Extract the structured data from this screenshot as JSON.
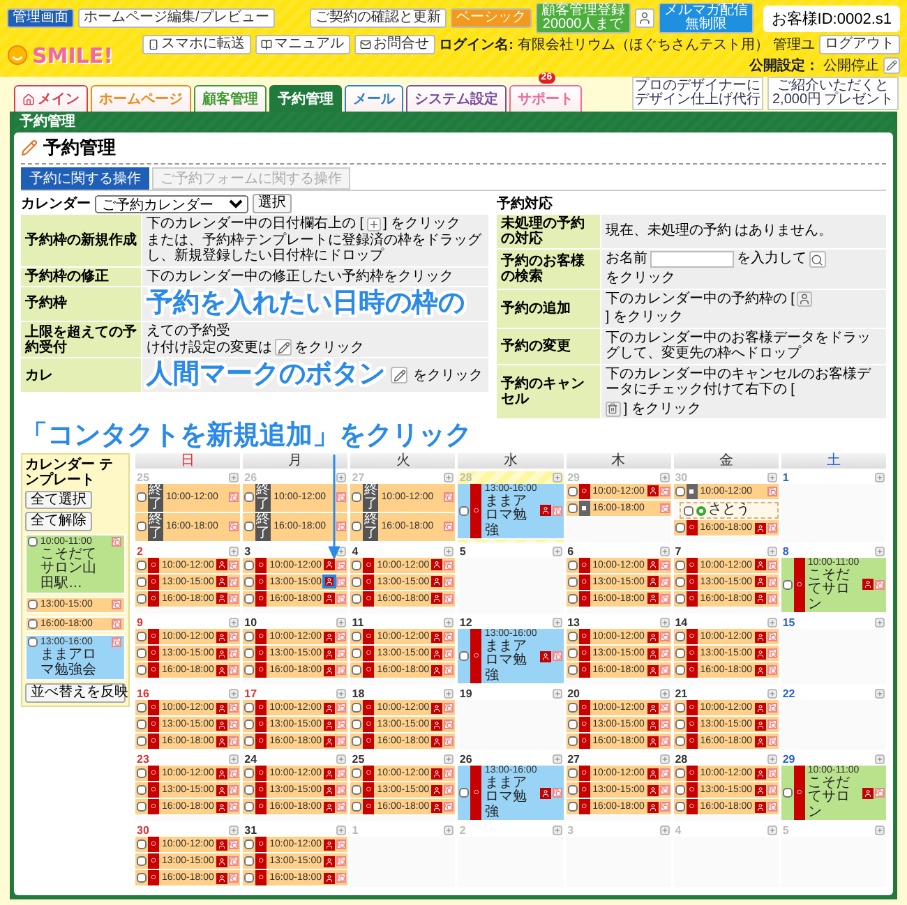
{
  "topbar": {
    "admin": "管理画面",
    "editor": "ホームページ編集/プレビュー",
    "contract": "ご契約の確認と更新",
    "plan": "ベーシック",
    "customers": [
      "顧客管理登録",
      "20000人まで"
    ],
    "mailmag": [
      "メルマガ配信",
      "無制限"
    ],
    "customer_id": "お客様ID:0002.s1"
  },
  "logo": "SMILE!",
  "userbar": {
    "links": [
      "スマホに転送",
      "マニュアル",
      "お問合せ"
    ],
    "login_label": "ログイン名:",
    "login_name": "有限会社リウム（ほぐちさんテスト用）",
    "role": "管理ユ",
    "logout": "ログアウト",
    "publish_label": "公開設定：",
    "publish_value": "公開停止"
  },
  "tabs": [
    {
      "label": "メイン",
      "selected": false,
      "color": "#d9404f"
    },
    {
      "label": "ホームページ",
      "selected": false,
      "color": "#f08a1c"
    },
    {
      "label": "顧客管理",
      "selected": false,
      "color": "#3f9a2f"
    },
    {
      "label": "予約管理",
      "selected": true,
      "color": "#1f7a3c"
    },
    {
      "label": "メール",
      "selected": false,
      "color": "#2f7fd0"
    },
    {
      "label": "システム設定",
      "selected": false,
      "color": "#7a4fa0"
    },
    {
      "label": "サポート",
      "selected": false,
      "color": "#f06a9a",
      "badge": "26"
    }
  ],
  "banners": [
    {
      "lines": [
        "プロのデザイナーに",
        "デザイン仕上げ代行"
      ]
    },
    {
      "lines": [
        "ご紹介いただくと",
        "2,000円",
        "プレゼント"
      ]
    }
  ],
  "panel": {
    "title": "予約管理",
    "heading": "予約管理",
    "subtabs": [
      {
        "label": "予約に関する操作",
        "selected": true
      },
      {
        "label": "ご予約フォームに関する操作",
        "selected": false
      }
    ]
  },
  "calendar_select": {
    "label": "カレンダー",
    "value": "ご予約カレンダー",
    "button": "選択"
  },
  "left_ops": [
    {
      "label": "予約枠の新規作成",
      "lines": [
        [
          {
            "kind": "text",
            "text": "下のカレンダー中の日付欄右上の ["
          },
          {
            "kind": "plus"
          },
          {
            "kind": "text",
            "text": "] をクリック"
          }
        ],
        [
          {
            "kind": "text",
            "text": "または、予約枠テンプレートに登録済の枠をドラッグし、新規登録したい日付枠にドロップ"
          }
        ]
      ]
    },
    {
      "label": "予約枠の修正",
      "lines": [
        [
          {
            "kind": "text",
            "text": "下のカレンダー中の修正したい予約枠をクリック"
          }
        ]
      ]
    },
    {
      "label": "予約枠",
      "callout": "予約を入れたい日時の枠の"
    },
    {
      "label": "上限を超えての予約受付",
      "lines": [
        [
          {
            "kind": "text",
            "text": "えての予約受"
          }
        ],
        [
          {
            "kind": "text",
            "text": "け付け設定の変更は"
          },
          {
            "kind": "pencil"
          },
          {
            "kind": "text",
            "text": "をクリック"
          }
        ]
      ]
    },
    {
      "label": "カレ",
      "callout": "人間マークのボタン",
      "lines": [
        [
          {
            "kind": "pencil"
          },
          {
            "kind": "text",
            "text": "をクリック"
          }
        ]
      ]
    }
  ],
  "right_ops": {
    "title": "予約対応",
    "rows": [
      {
        "label": "未処理の予約の対応",
        "lines": [
          [
            {
              "kind": "text",
              "text": "現在、未処理の予約 はありません。"
            }
          ]
        ]
      },
      {
        "label": "予約のお客様の検索",
        "lines": [
          [
            {
              "kind": "text",
              "text": "お名前"
            },
            {
              "kind": "input"
            },
            {
              "kind": "text",
              "text": "を入力して"
            },
            {
              "kind": "search"
            },
            {
              "kind": "text",
              "text": "をクリック"
            }
          ]
        ]
      },
      {
        "label": "予約の追加",
        "lines": [
          [
            {
              "kind": "text",
              "text": "下のカレンダー中の予約枠の ["
            },
            {
              "kind": "person"
            },
            {
              "kind": "text",
              "text": "] をクリック"
            }
          ]
        ]
      },
      {
        "label": "予約の変更",
        "lines": [
          [
            {
              "kind": "text",
              "text": "下のカレンダー中のお客様データをドラッグして、変更先の枠へドロップ"
            }
          ]
        ]
      },
      {
        "label": "予約のキャンセル",
        "lines": [
          [
            {
              "kind": "text",
              "text": "下のカレンダー中のキャンセルのお客様データにチェック付けて右下の ["
            },
            {
              "kind": "trash"
            },
            {
              "kind": "text",
              "text": "] をクリック"
            }
          ]
        ]
      }
    ]
  },
  "calendar_callout": "「コンタクトを新規追加」をクリック",
  "template": {
    "title": "カレンダー テンプレート",
    "buttons": [
      "全て選択",
      "全て解除"
    ],
    "items": [
      {
        "time": "10:00-11:00",
        "name": "こそだてサロン山田駅…",
        "color": "#b9e28c"
      },
      {
        "time": "13:00-15:00",
        "color": "#ffd08a"
      },
      {
        "time": "16:00-18:00",
        "color": "#ffd08a"
      },
      {
        "time": "13:00-16:00",
        "name": "ままアロマ勉強会",
        "color": "#99d3f5"
      }
    ],
    "apply": "並べ替えを反映"
  },
  "weekdays": [
    {
      "label": "日",
      "kind": "sun"
    },
    {
      "label": "月",
      "kind": "day"
    },
    {
      "label": "火",
      "kind": "day"
    },
    {
      "label": "水",
      "kind": "day"
    },
    {
      "label": "木",
      "kind": "day"
    },
    {
      "label": "金",
      "kind": "day"
    },
    {
      "label": "土",
      "kind": "sat"
    }
  ],
  "weeks": [
    {
      "days": [
        {
          "date": "25",
          "kind": "other",
          "today": false,
          "slots": [
            {
              "kind": "done",
              "time": "10:00-12:00",
              "mark": "終了",
              "color": "#ffd08a",
              "highlighted": false
            },
            {
              "kind": "done",
              "time": "16:00-18:00",
              "mark": "終了",
              "color": "#ffd08a",
              "highlighted": false
            }
          ]
        },
        {
          "date": "26",
          "kind": "other",
          "today": false,
          "slots": [
            {
              "kind": "done",
              "time": "10:00-12:00",
              "mark": "終了",
              "color": "#ffd08a",
              "highlighted": false
            },
            {
              "kind": "done",
              "time": "16:00-18:00",
              "mark": "終了",
              "color": "#ffd08a",
              "highlighted": false
            }
          ]
        },
        {
          "date": "27",
          "kind": "other",
          "today": false,
          "slots": [
            {
              "kind": "done",
              "time": "10:00-12:00",
              "mark": "終了",
              "color": "#ffd08a",
              "highlighted": false
            },
            {
              "kind": "done",
              "time": "16:00-18:00",
              "mark": "終了",
              "color": "#ffd08a",
              "highlighted": false
            }
          ]
        },
        {
          "date": "28",
          "kind": "other",
          "today": true,
          "slots": [
            {
              "kind": "open",
              "time": "13:00-16:00",
              "name": "ままアロマ勉強",
              "mark": "○",
              "color": "#99d3f5",
              "highlighted": false
            }
          ]
        },
        {
          "date": "29",
          "kind": "other",
          "today": false,
          "slots": [
            {
              "kind": "open",
              "time": "10:00-12:00",
              "mark": "○",
              "color": "#ffd08a",
              "highlighted": false
            },
            {
              "kind": "closed",
              "time": "16:00-18:00",
              "color": "#ffd08a",
              "highlighted": false
            }
          ]
        },
        {
          "date": "30",
          "kind": "other",
          "today": false,
          "slots": [
            {
              "kind": "closed",
              "time": "10:00-12:00",
              "color": "#ffd08a",
              "highlighted": false
            },
            {
              "kind": "booking",
              "name": "さとう"
            },
            {
              "kind": "open",
              "time": "16:00-18:00",
              "mark": "○",
              "color": "#ffd08a",
              "highlighted": false
            }
          ]
        },
        {
          "date": "1",
          "kind": "sat",
          "today": false
        }
      ]
    },
    {
      "days": [
        {
          "date": "2",
          "kind": "sun",
          "today": false,
          "slots": [
            {
              "kind": "open",
              "time": "10:00-12:00",
              "mark": "○",
              "color": "#ffd08a",
              "highlighted": false
            },
            {
              "kind": "open",
              "time": "13:00-15:00",
              "mark": "○",
              "color": "#ffd08a",
              "highlighted": false
            },
            {
              "kind": "open",
              "time": "16:00-18:00",
              "mark": "○",
              "color": "#ffd08a",
              "highlighted": false
            }
          ]
        },
        {
          "date": "3",
          "kind": "day",
          "today": false,
          "slots": [
            {
              "kind": "open",
              "time": "10:00-12:00",
              "mark": "○",
              "color": "#ffd08a",
              "highlighted": false
            },
            {
              "kind": "open",
              "time": "13:00-15:00",
              "mark": "○",
              "color": "#ffd08a",
              "highlighted": true
            },
            {
              "kind": "open",
              "time": "16:00-18:00",
              "mark": "○",
              "color": "#ffd08a",
              "highlighted": false
            }
          ]
        },
        {
          "date": "4",
          "kind": "day",
          "today": false,
          "slots": [
            {
              "kind": "open",
              "time": "10:00-12:00",
              "mark": "○",
              "color": "#ffd08a",
              "highlighted": false
            },
            {
              "kind": "open",
              "time": "13:00-15:00",
              "mark": "○",
              "color": "#ffd08a",
              "highlighted": false
            },
            {
              "kind": "open",
              "time": "16:00-18:00",
              "mark": "○",
              "color": "#ffd08a",
              "highlighted": false
            }
          ]
        },
        {
          "date": "5",
          "kind": "day",
          "today": false
        },
        {
          "date": "6",
          "kind": "day",
          "today": false,
          "slots": [
            {
              "kind": "open",
              "time": "10:00-12:00",
              "mark": "○",
              "color": "#ffd08a",
              "highlighted": false
            },
            {
              "kind": "open",
              "time": "13:00-15:00",
              "mark": "○",
              "color": "#ffd08a",
              "highlighted": false
            },
            {
              "kind": "open",
              "time": "16:00-18:00",
              "mark": "○",
              "color": "#ffd08a",
              "highlighted": false
            }
          ]
        },
        {
          "date": "7",
          "kind": "day",
          "today": false,
          "slots": [
            {
              "kind": "open",
              "time": "10:00-12:00",
              "mark": "○",
              "color": "#ffd08a",
              "highlighted": false
            },
            {
              "kind": "open",
              "time": "13:00-15:00",
              "mark": "○",
              "color": "#ffd08a",
              "highlighted": false
            },
            {
              "kind": "open",
              "time": "16:00-18:00",
              "mark": "○",
              "color": "#ffd08a",
              "highlighted": false
            }
          ]
        },
        {
          "date": "8",
          "kind": "sat",
          "today": false,
          "slots": [
            {
              "kind": "open",
              "time": "10:00-11:00",
              "name": "こそだてサロン",
              "mark": "○",
              "color": "#b9e28c",
              "highlighted": false
            }
          ]
        }
      ]
    },
    {
      "days": [
        {
          "date": "9",
          "kind": "sun",
          "today": false,
          "slots": [
            {
              "kind": "open",
              "time": "10:00-12:00",
              "mark": "○",
              "color": "#ffd08a",
              "highlighted": false
            },
            {
              "kind": "open",
              "time": "13:00-15:00",
              "mark": "○",
              "color": "#ffd08a",
              "highlighted": false
            },
            {
              "kind": "open",
              "time": "16:00-18:00",
              "mark": "○",
              "color": "#ffd08a",
              "highlighted": false
            }
          ]
        },
        {
          "date": "10",
          "kind": "day",
          "today": false,
          "slots": [
            {
              "kind": "open",
              "time": "10:00-12:00",
              "mark": "○",
              "color": "#ffd08a",
              "highlighted": false
            },
            {
              "kind": "open",
              "time": "13:00-15:00",
              "mark": "○",
              "color": "#ffd08a",
              "highlighted": false
            },
            {
              "kind": "open",
              "time": "16:00-18:00",
              "mark": "○",
              "color": "#ffd08a",
              "highlighted": false
            }
          ]
        },
        {
          "date": "11",
          "kind": "day",
          "today": false,
          "slots": [
            {
              "kind": "open",
              "time": "10:00-12:00",
              "mark": "○",
              "color": "#ffd08a",
              "highlighted": false
            },
            {
              "kind": "open",
              "time": "13:00-15:00",
              "mark": "○",
              "color": "#ffd08a",
              "highlighted": false
            },
            {
              "kind": "open",
              "time": "16:00-18:00",
              "mark": "○",
              "color": "#ffd08a",
              "highlighted": false
            }
          ]
        },
        {
          "date": "12",
          "kind": "day",
          "today": false,
          "slots": [
            {
              "kind": "open",
              "time": "13:00-16:00",
              "name": "ままアロマ勉強",
              "mark": "○",
              "color": "#99d3f5",
              "highlighted": false
            }
          ]
        },
        {
          "date": "13",
          "kind": "day",
          "today": false,
          "slots": [
            {
              "kind": "open",
              "time": "10:00-12:00",
              "mark": "○",
              "color": "#ffd08a",
              "highlighted": false
            },
            {
              "kind": "open",
              "time": "13:00-15:00",
              "mark": "○",
              "color": "#ffd08a",
              "highlighted": false
            },
            {
              "kind": "open",
              "time": "16:00-18:00",
              "mark": "○",
              "color": "#ffd08a",
              "highlighted": false
            }
          ]
        },
        {
          "date": "14",
          "kind": "day",
          "today": false,
          "slots": [
            {
              "kind": "open",
              "time": "10:00-12:00",
              "mark": "○",
              "color": "#ffd08a",
              "highlighted": false
            },
            {
              "kind": "open",
              "time": "13:00-15:00",
              "mark": "○",
              "color": "#ffd08a",
              "highlighted": false
            },
            {
              "kind": "open",
              "time": "16:00-18:00",
              "mark": "○",
              "color": "#ffd08a",
              "highlighted": false
            }
          ]
        },
        {
          "date": "15",
          "kind": "sat",
          "today": false
        }
      ]
    },
    {
      "days": [
        {
          "date": "16",
          "kind": "sun",
          "today": false,
          "slots": [
            {
              "kind": "open",
              "time": "10:00-12:00",
              "mark": "○",
              "color": "#ffd08a",
              "highlighted": false
            },
            {
              "kind": "open",
              "time": "13:00-15:00",
              "mark": "○",
              "color": "#ffd08a",
              "highlighted": false
            },
            {
              "kind": "open",
              "time": "16:00-18:00",
              "mark": "○",
              "color": "#ffd08a",
              "highlighted": false
            }
          ]
        },
        {
          "date": "17",
          "kind": "sun",
          "today": false,
          "slots": [
            {
              "kind": "open",
              "time": "10:00-12:00",
              "mark": "○",
              "color": "#ffd08a",
              "highlighted": false
            },
            {
              "kind": "open",
              "time": "13:00-15:00",
              "mark": "○",
              "color": "#ffd08a",
              "highlighted": false
            },
            {
              "kind": "open",
              "time": "16:00-18:00",
              "mark": "○",
              "color": "#ffd08a",
              "highlighted": false
            }
          ]
        },
        {
          "date": "18",
          "kind": "day",
          "today": false,
          "slots": [
            {
              "kind": "open",
              "time": "10:00-12:00",
              "mark": "○",
              "color": "#ffd08a",
              "highlighted": false
            },
            {
              "kind": "open",
              "time": "13:00-15:00",
              "mark": "○",
              "color": "#ffd08a",
              "highlighted": false
            },
            {
              "kind": "open",
              "time": "16:00-18:00",
              "mark": "○",
              "color": "#ffd08a",
              "highlighted": false
            }
          ]
        },
        {
          "date": "19",
          "kind": "day",
          "today": false
        },
        {
          "date": "20",
          "kind": "day",
          "today": false,
          "slots": [
            {
              "kind": "open",
              "time": "10:00-12:00",
              "mark": "○",
              "color": "#ffd08a",
              "highlighted": false
            },
            {
              "kind": "open",
              "time": "13:00-15:00",
              "mark": "○",
              "color": "#ffd08a",
              "highlighted": false
            },
            {
              "kind": "open",
              "time": "16:00-18:00",
              "mark": "○",
              "color": "#ffd08a",
              "highlighted": false
            }
          ]
        },
        {
          "date": "21",
          "kind": "day",
          "today": false,
          "slots": [
            {
              "kind": "open",
              "time": "10:00-12:00",
              "mark": "○",
              "color": "#ffd08a",
              "highlighted": false
            },
            {
              "kind": "open",
              "time": "13:00-15:00",
              "mark": "○",
              "color": "#ffd08a",
              "highlighted": false
            },
            {
              "kind": "open",
              "time": "16:00-18:00",
              "mark": "○",
              "color": "#ffd08a",
              "highlighted": false
            }
          ]
        },
        {
          "date": "22",
          "kind": "sat",
          "today": false
        }
      ]
    },
    {
      "days": [
        {
          "date": "23",
          "kind": "sun",
          "today": false,
          "slots": [
            {
              "kind": "open",
              "time": "10:00-12:00",
              "mark": "○",
              "color": "#ffd08a",
              "highlighted": false
            },
            {
              "kind": "open",
              "time": "13:00-15:00",
              "mark": "○",
              "color": "#ffd08a",
              "highlighted": false
            },
            {
              "kind": "open",
              "time": "16:00-18:00",
              "mark": "○",
              "color": "#ffd08a",
              "highlighted": false
            }
          ]
        },
        {
          "date": "24",
          "kind": "day",
          "today": false,
          "slots": [
            {
              "kind": "open",
              "time": "10:00-12:00",
              "mark": "○",
              "color": "#ffd08a",
              "highlighted": false
            },
            {
              "kind": "open",
              "time": "13:00-15:00",
              "mark": "○",
              "color": "#ffd08a",
              "highlighted": false
            },
            {
              "kind": "open",
              "time": "16:00-18:00",
              "mark": "○",
              "color": "#ffd08a",
              "highlighted": false
            }
          ]
        },
        {
          "date": "25",
          "kind": "day",
          "today": false,
          "slots": [
            {
              "kind": "open",
              "time": "10:00-12:00",
              "mark": "○",
              "color": "#ffd08a",
              "highlighted": false
            },
            {
              "kind": "open",
              "time": "13:00-15:00",
              "mark": "○",
              "color": "#ffd08a",
              "highlighted": false
            },
            {
              "kind": "open",
              "time": "16:00-18:00",
              "mark": "○",
              "color": "#ffd08a",
              "highlighted": false
            }
          ]
        },
        {
          "date": "26",
          "kind": "day",
          "today": false,
          "slots": [
            {
              "kind": "open",
              "time": "13:00-16:00",
              "name": "ままアロマ勉強",
              "mark": "○",
              "color": "#99d3f5",
              "highlighted": false
            }
          ]
        },
        {
          "date": "27",
          "kind": "day",
          "today": false,
          "slots": [
            {
              "kind": "open",
              "time": "10:00-12:00",
              "mark": "○",
              "color": "#ffd08a",
              "highlighted": false
            },
            {
              "kind": "open",
              "time": "13:00-15:00",
              "mark": "○",
              "color": "#ffd08a",
              "highlighted": false
            },
            {
              "kind": "open",
              "time": "16:00-18:00",
              "mark": "○",
              "color": "#ffd08a",
              "highlighted": false
            }
          ]
        },
        {
          "date": "28",
          "kind": "day",
          "today": false,
          "slots": [
            {
              "kind": "open",
              "time": "10:00-12:00",
              "mark": "○",
              "color": "#ffd08a",
              "highlighted": false
            },
            {
              "kind": "open",
              "time": "13:00-15:00",
              "mark": "○",
              "color": "#ffd08a",
              "highlighted": false
            },
            {
              "kind": "open",
              "time": "16:00-18:00",
              "mark": "○",
              "color": "#ffd08a",
              "highlighted": false
            }
          ]
        },
        {
          "date": "29",
          "kind": "sat",
          "today": false,
          "slots": [
            {
              "kind": "open",
              "time": "10:00-11:00",
              "name": "こそだてサロン",
              "mark": "○",
              "color": "#b9e28c",
              "highlighted": false
            }
          ]
        }
      ]
    },
    {
      "days": [
        {
          "date": "30",
          "kind": "sun",
          "today": false,
          "slots": [
            {
              "kind": "open",
              "time": "10:00-12:00",
              "mark": "○",
              "color": "#ffd08a",
              "highlighted": false
            },
            {
              "kind": "open",
              "time": "13:00-15:00",
              "mark": "○",
              "color": "#ffd08a",
              "highlighted": false
            },
            {
              "kind": "open",
              "time": "16:00-18:00",
              "mark": "○",
              "color": "#ffd08a",
              "highlighted": false
            }
          ]
        },
        {
          "date": "31",
          "kind": "day",
          "today": false,
          "slots": [
            {
              "kind": "open",
              "time": "10:00-12:00",
              "mark": "○",
              "color": "#ffd08a",
              "highlighted": false
            },
            {
              "kind": "open",
              "time": "13:00-15:00",
              "mark": "○",
              "color": "#ffd08a",
              "highlighted": false
            },
            {
              "kind": "open",
              "time": "16:00-18:00",
              "mark": "○",
              "color": "#ffd08a",
              "highlighted": false
            }
          ]
        },
        {
          "date": "1",
          "kind": "other",
          "today": false
        },
        {
          "date": "2",
          "kind": "other",
          "today": false
        },
        {
          "date": "3",
          "kind": "other",
          "today": false
        },
        {
          "date": "4",
          "kind": "other",
          "today": false
        },
        {
          "date": "5",
          "kind": "other",
          "today": false
        }
      ]
    }
  ]
}
